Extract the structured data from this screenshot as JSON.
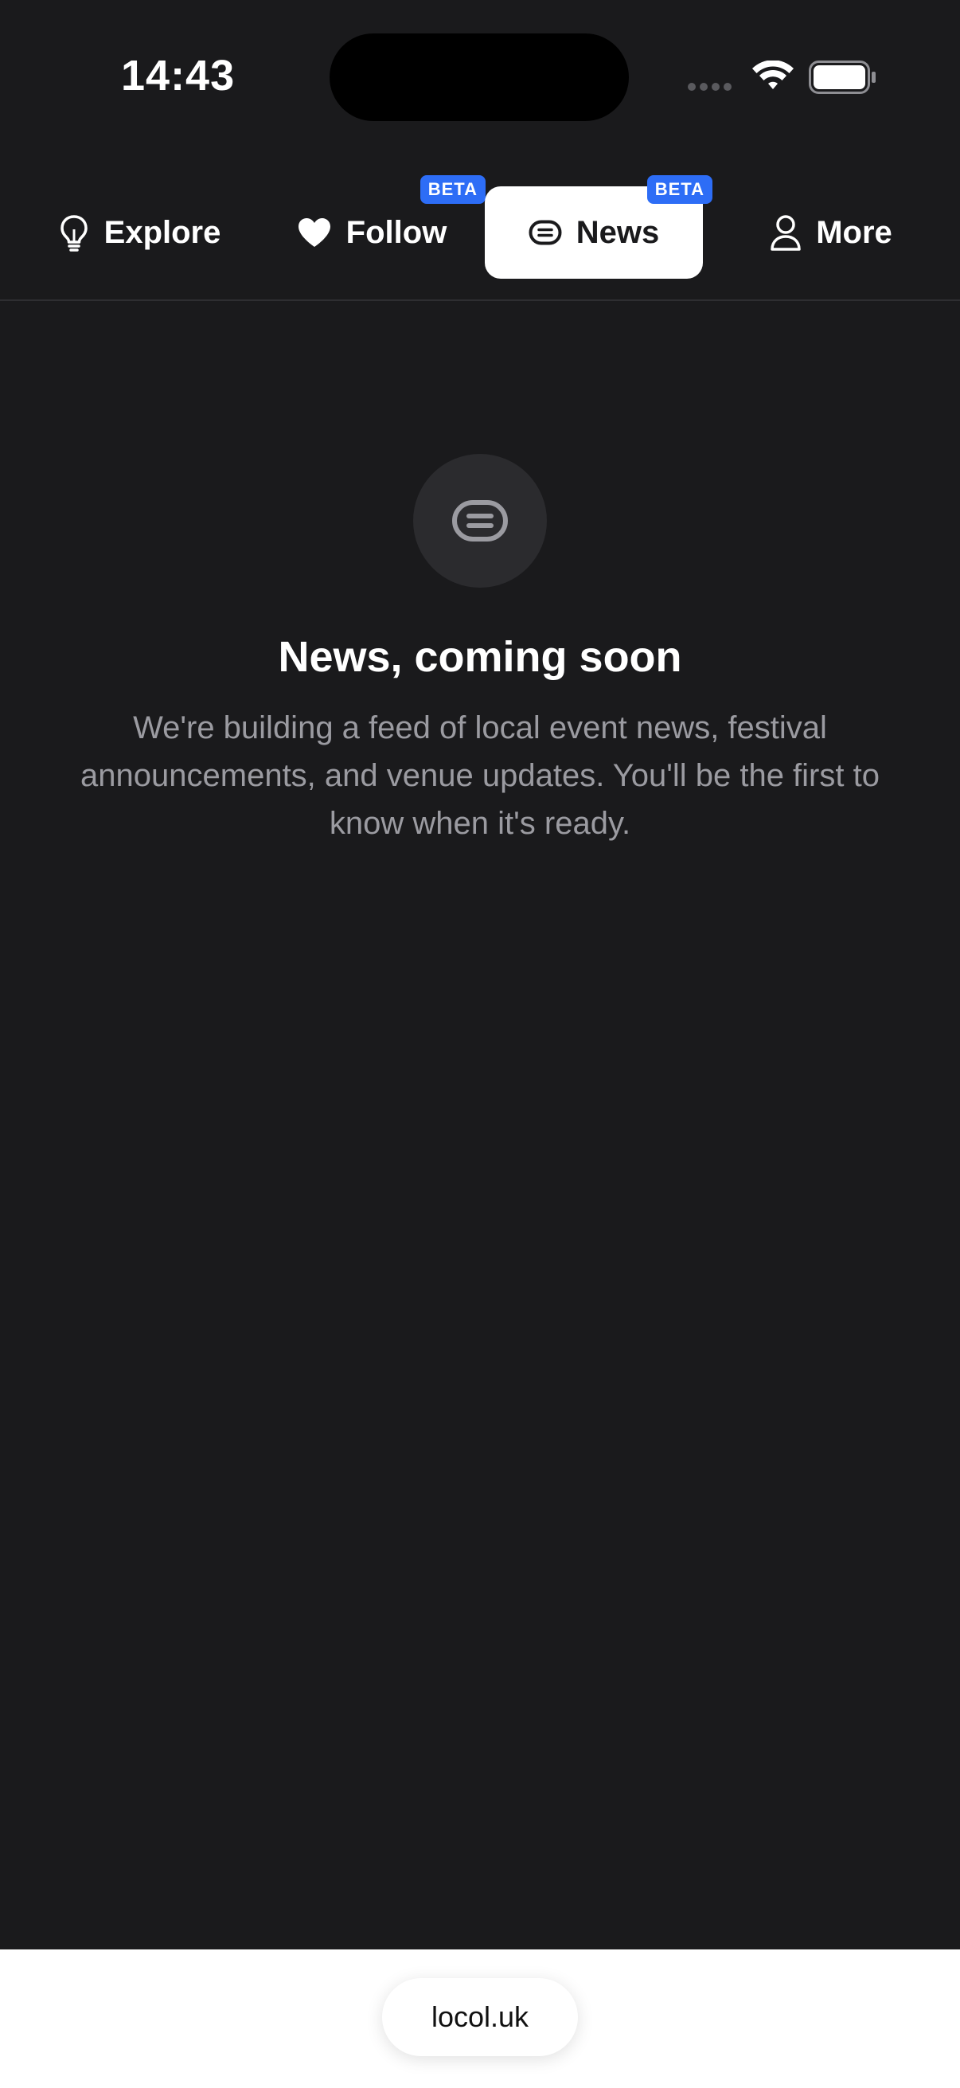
{
  "status_bar": {
    "time": "14:43",
    "icons": [
      "signal-dots-icon",
      "wifi-icon",
      "battery-icon"
    ]
  },
  "tabs": [
    {
      "label": "Explore",
      "icon": "lightbulb-icon",
      "active": false,
      "badge": ""
    },
    {
      "label": "Follow",
      "icon": "heart-icon",
      "active": false,
      "badge": "BETA"
    },
    {
      "label": "News",
      "icon": "capsule-news-icon",
      "active": true,
      "badge": "BETA"
    },
    {
      "label": "More",
      "icon": "person-icon",
      "active": false,
      "badge": ""
    }
  ],
  "empty_state": {
    "icon": "capsule-news-icon",
    "title": "News, coming soon",
    "description": "We're building a feed of local event news, festival announcements, and venue updates. You'll be the first to know when it's ready."
  },
  "browser": {
    "url": "locol.uk"
  },
  "colors": {
    "background": "#1a1a1c",
    "accent": "#2d6df6",
    "active_tab_bg": "#ffffff",
    "muted_text": "#9b9ba1"
  }
}
